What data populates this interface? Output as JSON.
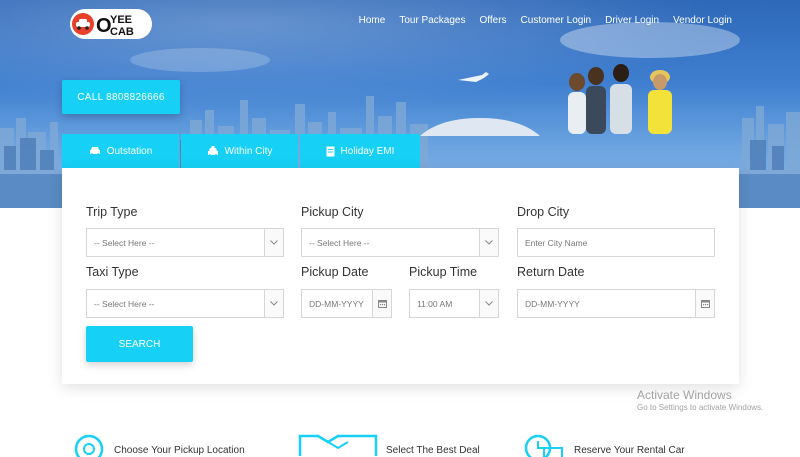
{
  "brand": {
    "logo_text_top": "YEE",
    "logo_letter": "O",
    "logo_text_bottom": "CAB"
  },
  "nav": {
    "items": [
      "Home",
      "Tour Packages",
      "Offers",
      "Customer Login",
      "Driver Login",
      "Vendor Login"
    ]
  },
  "call_button": "CALL 8808826666",
  "tabs": [
    {
      "label": "Outstation",
      "icon": "car-icon"
    },
    {
      "label": "Within City",
      "icon": "taxi-icon"
    },
    {
      "label": "Holiday EMI",
      "icon": "document-icon"
    }
  ],
  "form": {
    "trip_type": {
      "label": "Trip Type",
      "value": "-- Select Here --"
    },
    "pickup_city": {
      "label": "Pickup City",
      "value": "-- Select Here --"
    },
    "drop_city": {
      "label": "Drop City",
      "placeholder": "Enter City Name"
    },
    "taxi_type": {
      "label": "Taxi Type",
      "value": "-- Select Here --"
    },
    "pickup_date": {
      "label": "Pickup Date",
      "placeholder": "DD-MM-YYYY"
    },
    "pickup_time": {
      "label": "Pickup Time",
      "value": "11:00 AM"
    },
    "return_date": {
      "label": "Return Date",
      "placeholder": "DD-MM-YYYY"
    },
    "search_label": "SEARCH"
  },
  "watermark": {
    "title": "Activate Windows",
    "subtitle": "Go to Settings to activate Windows."
  },
  "features": [
    {
      "label": "Choose Your Pickup Location",
      "icon": "location-icon"
    },
    {
      "label": "Select The Best Deal",
      "icon": "handshake-icon"
    },
    {
      "label": "Reserve Your Rental Car",
      "icon": "calendar-icon"
    }
  ],
  "colors": {
    "accent": "#16d0f5",
    "logo_red": "#e8402a"
  }
}
